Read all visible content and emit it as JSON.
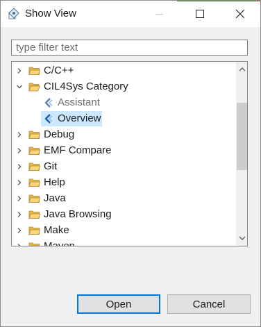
{
  "window": {
    "title": "Show View",
    "icon": "show-view-icon",
    "controls": {
      "minimize_icon": "minimize-icon",
      "maximize_icon": "maximize-icon",
      "close_icon": "close-icon"
    }
  },
  "filter": {
    "placeholder": "type filter text",
    "value": ""
  },
  "tree": {
    "items": [
      {
        "label": "C/C++",
        "type": "folder",
        "expanded": false,
        "level": 0
      },
      {
        "label": "CIL4Sys Category",
        "type": "folder",
        "expanded": true,
        "level": 0
      },
      {
        "label": "Assistant",
        "type": "view",
        "level": 1,
        "disabled": true
      },
      {
        "label": "Overview",
        "type": "view",
        "level": 1,
        "selected": true
      },
      {
        "label": "Debug",
        "type": "folder",
        "expanded": false,
        "level": 0
      },
      {
        "label": "EMF Compare",
        "type": "folder",
        "expanded": false,
        "level": 0
      },
      {
        "label": "Git",
        "type": "folder",
        "expanded": false,
        "level": 0
      },
      {
        "label": "Help",
        "type": "folder",
        "expanded": false,
        "level": 0
      },
      {
        "label": "Java",
        "type": "folder",
        "expanded": false,
        "level": 0
      },
      {
        "label": "Java Browsing",
        "type": "folder",
        "expanded": false,
        "level": 0
      },
      {
        "label": "Make",
        "type": "folder",
        "expanded": false,
        "level": 0
      },
      {
        "label": "Maven",
        "type": "folder",
        "expanded": false,
        "level": 0
      }
    ]
  },
  "buttons": {
    "open_label": "Open",
    "cancel_label": "Cancel"
  },
  "colors": {
    "selection": "#cce8ff",
    "default_button_border": "#0078d7",
    "folder": "#e8b94a",
    "view_icon": "#1f5ea8"
  }
}
